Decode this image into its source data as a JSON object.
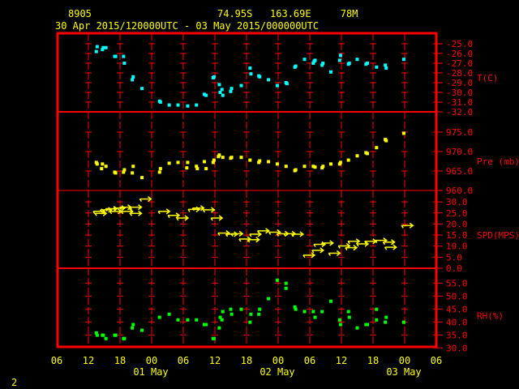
{
  "header": {
    "station": "8905",
    "location": "74.95S   163.69E     78M",
    "period": "30 Apr 2015/120000UTC - 03 May 2015/000000UTC"
  },
  "page_number": "2",
  "colors": {
    "frame": "#ff0000",
    "text": "#ffff00",
    "temperature": "#00ffff",
    "pressure": "#ffff00",
    "wind": "#ffff00",
    "humidity": "#00ff00"
  },
  "chart_data": {
    "type": "scatter",
    "x_axis": {
      "start": "04-30 06:00",
      "end": "05-03 06:00",
      "tick_labels": [
        "06",
        "12",
        "18",
        "00",
        "06",
        "12",
        "18",
        "00",
        "06",
        "12",
        "18",
        "00",
        "06"
      ],
      "date_labels": [
        "01 May",
        "02 May",
        "03 May"
      ],
      "grid": true
    },
    "panels": [
      {
        "name": "T(C)",
        "ylim": [
          -32,
          -23.9
        ],
        "tick_labels": [
          "-25.0",
          "-26.0",
          "-27.0",
          "-28.0",
          "-29.0",
          "-30.0",
          "-31.0",
          "-32.0"
        ],
        "ticks": [
          -25,
          -26,
          -27,
          -28,
          -29,
          -30,
          -31,
          -32
        ],
        "marker": "square",
        "points": [
          [
            "04-30 13:30",
            -25.8
          ],
          [
            "04-30 13:40",
            -25.3
          ],
          [
            "04-30 14:40",
            -25.6
          ],
          [
            "04-30 14:50",
            -25.4
          ],
          [
            "04-30 15:20",
            -25.4
          ],
          [
            "04-30 17:00",
            -26.3
          ],
          [
            "04-30 17:10",
            -26.3
          ],
          [
            "04-30 18:40",
            -26.3
          ],
          [
            "04-30 18:50",
            -27.0
          ],
          [
            "04-30 20:20",
            -28.7
          ],
          [
            "04-30 20:30",
            -28.4
          ],
          [
            "04-30 22:10",
            -29.6
          ],
          [
            "05-01 01:30",
            -30.9
          ],
          [
            "05-01 01:40",
            -31.0
          ],
          [
            "05-01 03:20",
            -31.3
          ],
          [
            "05-01 05:00",
            -31.3
          ],
          [
            "05-01 06:50",
            -31.4
          ],
          [
            "05-01 08:30",
            -31.3
          ],
          [
            "05-01 10:00",
            -30.2
          ],
          [
            "05-01 10:20",
            -30.3
          ],
          [
            "05-01 11:40",
            -28.5
          ],
          [
            "05-01 11:50",
            -28.4
          ],
          [
            "05-01 12:50",
            -29.2
          ],
          [
            "05-01 13:00",
            -30.0
          ],
          [
            "05-01 13:20",
            -29.7
          ],
          [
            "05-01 13:30",
            -30.3
          ],
          [
            "05-01 15:00",
            -29.9
          ],
          [
            "05-01 15:10",
            -29.6
          ],
          [
            "05-01 17:00",
            -29.3
          ],
          [
            "05-01 18:40",
            -27.5
          ],
          [
            "05-01 18:50",
            -28.1
          ],
          [
            "05-01 20:20",
            -28.3
          ],
          [
            "05-01 20:30",
            -28.4
          ],
          [
            "05-01 22:10",
            -28.7
          ],
          [
            "05-01 23:50",
            -29.3
          ],
          [
            "05-02 01:30",
            -29.0
          ],
          [
            "05-02 01:40",
            -29.1
          ],
          [
            "05-02 03:10",
            -27.4
          ],
          [
            "05-02 03:20",
            -27.3
          ],
          [
            "05-02 05:00",
            -26.6
          ],
          [
            "05-02 06:40",
            -27.0
          ],
          [
            "05-02 06:50",
            -26.8
          ],
          [
            "05-02 07:00",
            -26.7
          ],
          [
            "05-02 08:20",
            -27.2
          ],
          [
            "05-02 08:30",
            -27.0
          ],
          [
            "05-02 10:00",
            -27.9
          ],
          [
            "05-02 11:40",
            -26.7
          ],
          [
            "05-02 11:50",
            -26.2
          ],
          [
            "05-02 13:20",
            -27.1
          ],
          [
            "05-02 13:30",
            -27.0
          ],
          [
            "05-02 15:00",
            -26.6
          ],
          [
            "05-02 16:40",
            -27.1
          ],
          [
            "05-02 16:55",
            -27.0
          ],
          [
            "05-02 18:40",
            -27.4
          ],
          [
            "05-02 20:20",
            -27.2
          ],
          [
            "05-02 20:30",
            -27.5
          ],
          [
            "05-02 23:50",
            -26.6
          ]
        ]
      },
      {
        "name": "Pre (mb)",
        "ylim": [
          960,
          980.2
        ],
        "tick_labels": [
          "975.0",
          "970.0",
          "965.0",
          "960.0"
        ],
        "ticks": [
          975,
          970,
          965,
          960
        ],
        "marker": "square",
        "points": [
          [
            "04-30 13:30",
            967.2
          ],
          [
            "04-30 13:40",
            966.8
          ],
          [
            "04-30 14:40",
            966.8
          ],
          [
            "04-30 14:30",
            965.6
          ],
          [
            "04-30 15:20",
            966.2
          ],
          [
            "04-30 17:00",
            964.7
          ],
          [
            "04-30 17:10",
            964.5
          ],
          [
            "04-30 18:40",
            964.7
          ],
          [
            "04-30 18:50",
            965.3
          ],
          [
            "04-30 20:20",
            964.5
          ],
          [
            "04-30 20:30",
            966.2
          ],
          [
            "04-30 22:10",
            963.3
          ],
          [
            "05-01 01:30",
            964.7
          ],
          [
            "05-01 01:40",
            965.6
          ],
          [
            "05-01 03:20",
            967.0
          ],
          [
            "05-01 05:00",
            967.2
          ],
          [
            "05-01 06:50",
            967.2
          ],
          [
            "05-01 06:40",
            965.8
          ],
          [
            "05-01 08:30",
            966.2
          ],
          [
            "05-01 08:40",
            965.6
          ],
          [
            "05-01 10:00",
            967.4
          ],
          [
            "05-01 10:20",
            965.6
          ],
          [
            "05-01 11:40",
            967.2
          ],
          [
            "05-01 11:50",
            967.8
          ],
          [
            "05-01 12:50",
            969.1
          ],
          [
            "05-01 12:40",
            968.7
          ],
          [
            "05-01 13:30",
            968.5
          ],
          [
            "05-01 15:00",
            968.3
          ],
          [
            "05-01 15:10",
            968.5
          ],
          [
            "05-01 17:00",
            968.5
          ],
          [
            "05-01 18:40",
            967.8
          ],
          [
            "05-01 20:20",
            967.2
          ],
          [
            "05-01 20:30",
            967.6
          ],
          [
            "05-01 22:10",
            967.4
          ],
          [
            "05-01 23:50",
            966.8
          ],
          [
            "05-02 01:30",
            966.2
          ],
          [
            "05-02 03:10",
            965.1
          ],
          [
            "05-02 03:20",
            965.3
          ],
          [
            "05-02 05:00",
            966.2
          ],
          [
            "05-02 06:40",
            966.2
          ],
          [
            "05-02 07:00",
            966.0
          ],
          [
            "05-02 08:20",
            965.8
          ],
          [
            "05-02 08:30",
            966.2
          ],
          [
            "05-02 10:00",
            966.8
          ],
          [
            "05-02 11:40",
            966.8
          ],
          [
            "05-02 11:50",
            967.2
          ],
          [
            "05-02 13:20",
            967.8
          ],
          [
            "05-02 15:00",
            968.9
          ],
          [
            "05-02 16:40",
            969.7
          ],
          [
            "05-02 16:55",
            969.5
          ],
          [
            "05-02 18:40",
            971.0
          ],
          [
            "05-02 20:20",
            973.1
          ],
          [
            "05-02 20:30",
            972.8
          ],
          [
            "05-02 23:50",
            974.7
          ]
        ]
      },
      {
        "name": "SPD(MPS)",
        "ylim": [
          0,
          35
        ],
        "tick_labels": [
          "30.0",
          "25.0",
          "20.0",
          "15.0",
          "10.0",
          "5.0",
          "0.0"
        ],
        "ticks": [
          30,
          25,
          20,
          15,
          10,
          5,
          0
        ],
        "marker": "wind-arrow",
        "arrow_direction": "right",
        "points": [
          [
            "04-30 14:20",
            24.8
          ],
          [
            "04-30 14:00",
            25.7
          ],
          [
            "04-30 15:20",
            26.4
          ],
          [
            "04-30 16:20",
            26.9
          ],
          [
            "04-30 17:10",
            25.7
          ],
          [
            "04-30 17:50",
            27.2
          ],
          [
            "04-30 19:20",
            25.7
          ],
          [
            "04-30 19:00",
            27.6
          ],
          [
            "04-30 21:00",
            24.8
          ],
          [
            "04-30 21:00",
            27.6
          ],
          [
            "04-30 22:50",
            31.3
          ],
          [
            "05-01 02:20",
            25.7
          ],
          [
            "05-01 04:10",
            23.9
          ],
          [
            "05-01 05:50",
            22.7
          ],
          [
            "05-01 08:00",
            26.6
          ],
          [
            "05-01 08:50",
            27.2
          ],
          [
            "05-01 10:50",
            26.4
          ],
          [
            "05-01 12:20",
            22.7
          ],
          [
            "05-01 13:40",
            15.9
          ],
          [
            "05-01 15:10",
            15.4
          ],
          [
            "05-01 16:10",
            15.6
          ],
          [
            "05-01 17:40",
            13.2
          ],
          [
            "05-01 19:20",
            12.9
          ],
          [
            "05-01 19:40",
            15.4
          ],
          [
            "05-01 21:10",
            16.9
          ],
          [
            "05-01 23:20",
            16.3
          ],
          [
            "05-02 00:50",
            15.6
          ],
          [
            "05-02 02:10",
            15.6
          ],
          [
            "05-02 03:40",
            15.4
          ],
          [
            "05-02 05:50",
            5.9
          ],
          [
            "05-02 07:30",
            8.1
          ],
          [
            "05-02 07:50",
            10.8
          ],
          [
            "05-02 09:20",
            11.4
          ],
          [
            "05-02 10:40",
            6.8
          ],
          [
            "05-02 12:30",
            10.1
          ],
          [
            "05-02 13:50",
            9.3
          ],
          [
            "05-02 14:20",
            12.2
          ],
          [
            "05-02 16:00",
            11.0
          ],
          [
            "05-02 17:30",
            12.2
          ],
          [
            "05-02 19:30",
            12.6
          ],
          [
            "05-02 21:00",
            11.8
          ],
          [
            "05-02 21:20",
            9.5
          ],
          [
            "05-03 00:30",
            19.3
          ]
        ]
      },
      {
        "name": "RH(%)",
        "ylim": [
          30,
          61
        ],
        "tick_labels": [
          "55.0",
          "50.0",
          "45.0",
          "40.0",
          "35.0",
          "30.0"
        ],
        "ticks": [
          55,
          50,
          45,
          40,
          35,
          30
        ],
        "marker": "square",
        "points": [
          [
            "04-30 13:30",
            35.8
          ],
          [
            "04-30 13:40",
            34.9
          ],
          [
            "04-30 14:40",
            34.9
          ],
          [
            "04-30 14:50",
            34.9
          ],
          [
            "04-30 15:20",
            33.6
          ],
          [
            "04-30 17:00",
            34.9
          ],
          [
            "04-30 17:10",
            34.9
          ],
          [
            "04-30 18:40",
            33.6
          ],
          [
            "04-30 18:50",
            33.6
          ],
          [
            "04-30 20:20",
            37.7
          ],
          [
            "04-30 20:30",
            39.0
          ],
          [
            "04-30 22:10",
            36.8
          ],
          [
            "05-01 01:30",
            41.8
          ],
          [
            "05-01 03:20",
            43.0
          ],
          [
            "05-01 05:00",
            40.8
          ],
          [
            "05-01 06:50",
            40.8
          ],
          [
            "05-01 08:30",
            40.8
          ],
          [
            "05-01 10:00",
            39.0
          ],
          [
            "05-01 10:20",
            39.0
          ],
          [
            "05-01 11:40",
            33.6
          ],
          [
            "05-01 11:50",
            33.6
          ],
          [
            "05-01 12:50",
            37.7
          ],
          [
            "05-01 13:00",
            41.8
          ],
          [
            "05-01 13:20",
            40.8
          ],
          [
            "05-01 13:30",
            44.0
          ],
          [
            "05-01 15:00",
            44.9
          ],
          [
            "05-01 15:10",
            43.0
          ],
          [
            "05-01 17:00",
            44.9
          ],
          [
            "05-01 18:40",
            39.9
          ],
          [
            "05-01 18:50",
            43.0
          ],
          [
            "05-01 20:20",
            43.0
          ],
          [
            "05-01 20:30",
            44.9
          ],
          [
            "05-01 22:10",
            49.0
          ],
          [
            "05-01 23:50",
            56.1
          ],
          [
            "05-02 01:30",
            54.9
          ],
          [
            "05-02 01:30",
            53.0
          ],
          [
            "05-02 03:10",
            45.8
          ],
          [
            "05-02 03:20",
            44.9
          ],
          [
            "05-02 05:00",
            44.0
          ],
          [
            "05-02 06:40",
            44.0
          ],
          [
            "05-02 07:00",
            41.8
          ],
          [
            "05-02 08:20",
            44.0
          ],
          [
            "05-02 10:00",
            48.0
          ],
          [
            "05-02 11:40",
            40.8
          ],
          [
            "05-02 11:50",
            39.0
          ],
          [
            "05-02 13:20",
            44.0
          ],
          [
            "05-02 13:30",
            41.8
          ],
          [
            "05-02 15:00",
            37.7
          ],
          [
            "05-02 16:40",
            39.0
          ],
          [
            "05-02 16:55",
            39.0
          ],
          [
            "05-02 18:40",
            44.9
          ],
          [
            "05-02 18:40",
            40.8
          ],
          [
            "05-02 20:30",
            41.8
          ],
          [
            "05-02 20:20",
            39.9
          ],
          [
            "05-02 23:50",
            39.9
          ]
        ]
      }
    ]
  }
}
